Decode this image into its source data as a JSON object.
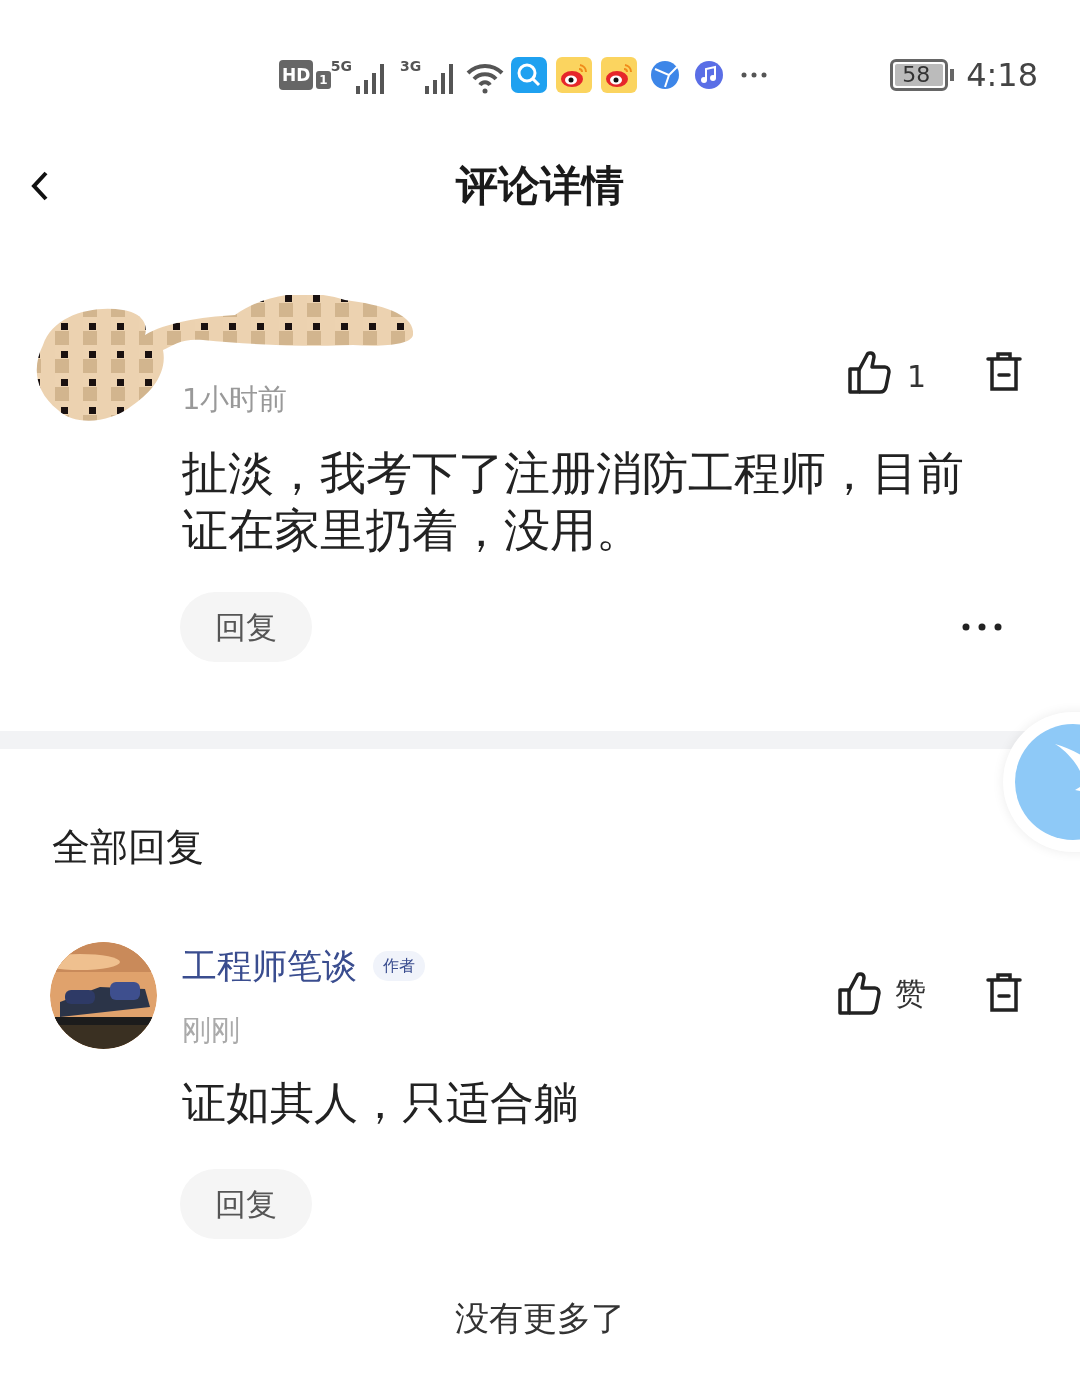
{
  "status_bar": {
    "hd": "HD",
    "sim_slot": "1",
    "network_1": "5G",
    "network_2": "3G",
    "battery": "58",
    "time": "4:18"
  },
  "header": {
    "title": "评论详情"
  },
  "comment": {
    "time": "1小时前",
    "likes": "1",
    "text": "扯淡，我考下了注册消防工程师，目前证在家里扔着，没用。",
    "reply_button": "回复"
  },
  "replies_section": {
    "title": "全部回复"
  },
  "replies": [
    {
      "author": "工程师笔谈",
      "badge": "作者",
      "time": "刚刚",
      "like_label": "赞",
      "text": "证如其人，只适合躺",
      "reply_button": "回复"
    }
  ],
  "footer": "没有更多了"
}
